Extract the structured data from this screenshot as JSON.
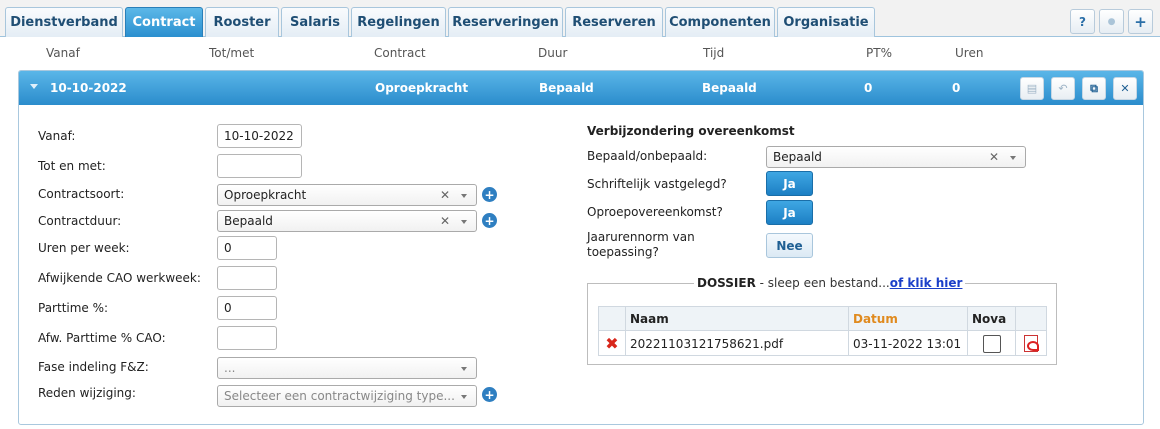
{
  "tabs": [
    {
      "label": "Dienstverband",
      "active": false
    },
    {
      "label": "Contract",
      "active": true
    },
    {
      "label": "Rooster",
      "active": false
    },
    {
      "label": "Salaris",
      "active": false
    },
    {
      "label": "Regelingen",
      "active": false
    },
    {
      "label": "Reserveringen",
      "active": false
    },
    {
      "label": "Reserveren",
      "active": false
    },
    {
      "label": "Componenten",
      "active": false
    },
    {
      "label": "Organisatie",
      "active": false
    }
  ],
  "toolbar": {
    "help_label": "?",
    "info_label": "●",
    "add_label": "+"
  },
  "columns": {
    "vanaf": "Vanaf",
    "totmet": "Tot/met",
    "contract": "Contract",
    "duur": "Duur",
    "tijd": "Tijd",
    "pt": "PT%",
    "uren": "Uren"
  },
  "record": {
    "vanaf": "10-10-2022",
    "contract": "Oproepkracht",
    "duur": "Bepaald",
    "tijd": "Bepaald",
    "pt": "0",
    "uren": "0"
  },
  "form": {
    "vanaf": {
      "label": "Vanaf:",
      "value": "10-10-2022"
    },
    "totenmet": {
      "label": "Tot en met:",
      "value": ""
    },
    "contractsoort": {
      "label": "Contractsoort:",
      "value": "Oproepkracht"
    },
    "contractduur": {
      "label": "Contractduur:",
      "value": "Bepaald"
    },
    "urenperweek": {
      "label": "Uren per week:",
      "value": "0"
    },
    "afwcao": {
      "label": "Afwijkende CAO werkweek:",
      "value": ""
    },
    "parttime": {
      "label": "Parttime %:",
      "value": "0"
    },
    "afwparttime": {
      "label": "Afw. Parttime % CAO:",
      "value": ""
    },
    "fase": {
      "label": "Fase indeling F&Z:",
      "value": "..."
    },
    "reden": {
      "label": "Reden wijziging:",
      "placeholder": "Selecteer een contractwijziging type..."
    }
  },
  "verbijzondering": {
    "title": "Verbijzondering overeenkomst",
    "bepaald_label": "Bepaald/onbepaald:",
    "bepaald_value": "Bepaald",
    "schriftelijk_label": "Schriftelijk vastgelegd?",
    "schriftelijk_value": "Ja",
    "oproep_label": "Oproepovereenkomst?",
    "oproep_value": "Ja",
    "jaarurennorm_label_1": "Jaarurennorm van",
    "jaarurennorm_label_2": "toepassing?",
    "jaarurennorm_value": "Nee"
  },
  "dossier": {
    "title": "DOSSIER",
    "hint": "- sleep een bestand...",
    "link": "of klik hier",
    "columns": {
      "naam": "Naam",
      "datum": "Datum",
      "nova": "Nova"
    },
    "rows": [
      {
        "naam": "20221103121758621.pdf",
        "datum": "03-11-2022 13:01"
      }
    ]
  },
  "colors": {
    "accent": "#2b8ccc",
    "datum_header": "#e08a1e"
  }
}
